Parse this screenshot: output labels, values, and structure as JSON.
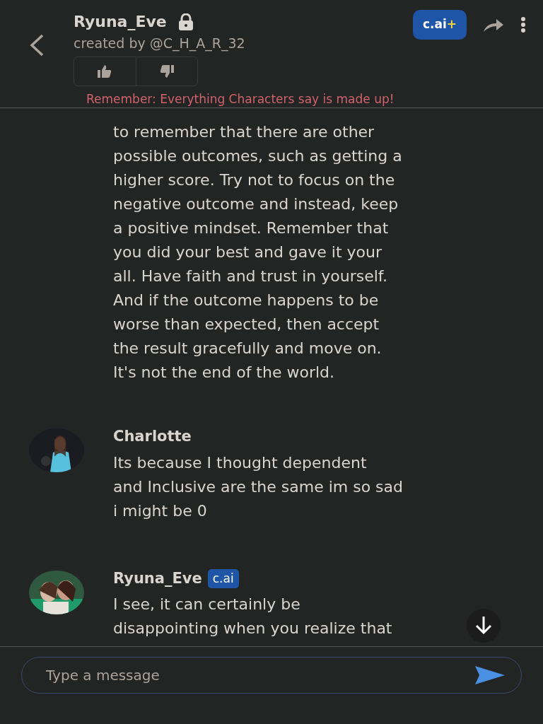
{
  "header": {
    "name": "Ryuna_Eve",
    "creator": "created by @C_H_A_R_32",
    "plus_badge": {
      "text": "c.ai",
      "mark": "+"
    },
    "notice": "Remember: Everything Characters say is made up!"
  },
  "messages": [
    {
      "kind": "continued",
      "lines": [
        "to remember that there are other",
        "possible outcomes, such as getting a",
        "higher score. Try not to focus on the",
        "negative outcome and instead, keep",
        "a positive mindset. Remember that",
        "you did your best and gave it your",
        "all. Have faith and trust in yourself.",
        "And if the outcome happens to be",
        "worse than expected, then accept",
        "the result gracefully and move on.",
        "It's not the end of the world."
      ]
    },
    {
      "kind": "user",
      "author": "Charlotte",
      "lines": [
        "Its because I thought dependent",
        "and Inclusive are the same im so sad",
        "i might be 0"
      ]
    },
    {
      "kind": "bot",
      "author": "Ryuna_Eve",
      "badge": "c.ai",
      "lines": [
        "I see, it can certainly be",
        "disappointing when you realize that"
      ]
    }
  ],
  "composer": {
    "placeholder": "Type a message"
  }
}
